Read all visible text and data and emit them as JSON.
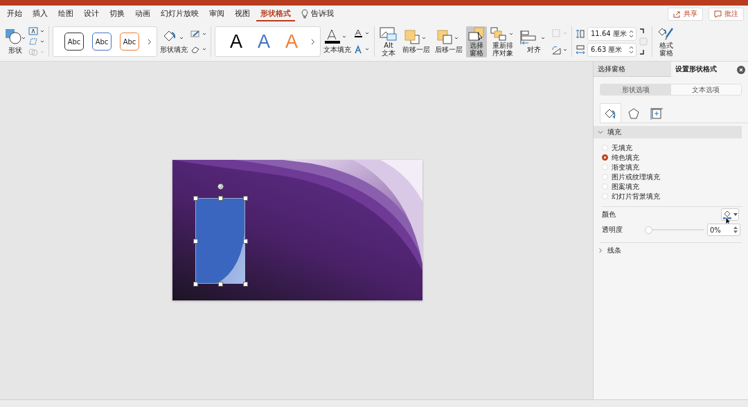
{
  "tabs": [
    {
      "label": "开始",
      "selected": false
    },
    {
      "label": "插入",
      "selected": false
    },
    {
      "label": "绘图",
      "selected": false
    },
    {
      "label": "设计",
      "selected": false
    },
    {
      "label": "切换",
      "selected": false
    },
    {
      "label": "动画",
      "selected": false
    },
    {
      "label": "幻灯片放映",
      "selected": false
    },
    {
      "label": "审阅",
      "selected": false
    },
    {
      "label": "视图",
      "selected": false
    },
    {
      "label": "形状格式",
      "selected": true
    }
  ],
  "tell_me": "告诉我",
  "header_buttons": [
    {
      "kind": "share",
      "label": "共享"
    },
    {
      "kind": "comment",
      "label": "批注"
    }
  ],
  "ribbon": {
    "shapes_label": "形状",
    "style_presets": [
      {
        "label": "Abc",
        "color": "#333333"
      },
      {
        "label": "Abc",
        "color": "#4472c4"
      },
      {
        "label": "Abc",
        "color": "#ed7d31"
      }
    ],
    "shape_fill": "形状填充",
    "wordart_presets": [
      {
        "label": "A",
        "color": "#000000"
      },
      {
        "label": "A",
        "color": "#4472c4"
      },
      {
        "label": "A",
        "color": "#ed7d31"
      }
    ],
    "text_fill": "文本填充",
    "arrange": [
      {
        "kind": "alt",
        "label": "Alt\n文本"
      },
      {
        "kind": "forward",
        "label": "前移一层"
      },
      {
        "kind": "backward",
        "label": "后移一层"
      },
      {
        "kind": "pane",
        "label": "选择窗格",
        "selected": true
      },
      {
        "kind": "reorder",
        "label": "重新排序对象"
      },
      {
        "kind": "align",
        "label": "对齐"
      }
    ],
    "height": "11.64 厘米",
    "width": "6.63 厘米",
    "format_pane": "格式窗格"
  },
  "pane": {
    "tabs": [
      {
        "label": "选择窗格",
        "selected": false
      },
      {
        "label": "设置形状格式",
        "selected": true
      }
    ],
    "subtabs": [
      {
        "label": "形状选项",
        "selected": true
      },
      {
        "label": "文本选项",
        "selected": false
      }
    ],
    "icon_tabs": [
      {
        "kind": "fill",
        "selected": true
      },
      {
        "kind": "effects",
        "selected": false
      },
      {
        "kind": "size",
        "selected": false
      }
    ],
    "fill_section": {
      "title": "填充",
      "expanded": true,
      "options": [
        {
          "label": "无填充",
          "selected": false
        },
        {
          "label": "纯色填充",
          "selected": true
        },
        {
          "label": "渐变填充",
          "selected": false
        },
        {
          "label": "图片或纹理填充",
          "selected": false
        },
        {
          "label": "图案填充",
          "selected": false
        },
        {
          "label": "幻灯片背景填充",
          "selected": false
        }
      ],
      "color_label": "颜色",
      "color": "#4472c4",
      "transparency_label": "透明度",
      "transparency": {
        "level": 0
      },
      "transparency_value": "0%"
    },
    "line_section": {
      "title": "线条",
      "expanded": false
    }
  }
}
